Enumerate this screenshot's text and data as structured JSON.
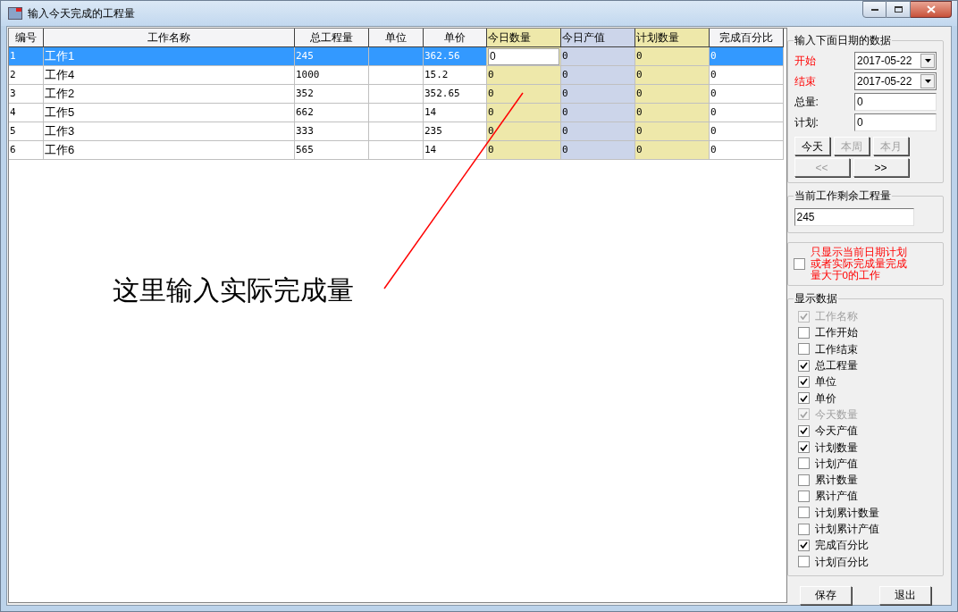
{
  "window": {
    "title": "输入今天完成的工程量"
  },
  "table": {
    "columns": [
      {
        "label": "编号"
      },
      {
        "label": "工作名称"
      },
      {
        "label": "总工程量"
      },
      {
        "label": "单位"
      },
      {
        "label": "单价"
      },
      {
        "label": "今日数量",
        "color": "#eee8aa",
        "kind": "input"
      },
      {
        "label": "今日产值",
        "color": "#ccd5ea"
      },
      {
        "label": "计划数量",
        "color": "#eee8aa"
      },
      {
        "label": "完成百分比"
      }
    ],
    "rows": [
      {
        "selected": true,
        "editing": true,
        "cells": [
          "1",
          "工作1",
          "245",
          "",
          "362.56",
          "0",
          "0",
          "0",
          "0"
        ]
      },
      {
        "selected": false,
        "editing": false,
        "cells": [
          "2",
          "工作4",
          "1000",
          "",
          "15.2",
          "0",
          "0",
          "0",
          "0"
        ]
      },
      {
        "selected": false,
        "editing": false,
        "cells": [
          "3",
          "工作2",
          "352",
          "",
          "352.65",
          "0",
          "0",
          "0",
          "0"
        ]
      },
      {
        "selected": false,
        "editing": false,
        "cells": [
          "4",
          "工作5",
          "662",
          "",
          "14",
          "0",
          "0",
          "0",
          "0"
        ]
      },
      {
        "selected": false,
        "editing": false,
        "cells": [
          "5",
          "工作3",
          "333",
          "",
          "235",
          "0",
          "0",
          "0",
          "0"
        ]
      },
      {
        "selected": false,
        "editing": false,
        "cells": [
          "6",
          "工作6",
          "565",
          "",
          "14",
          "0",
          "0",
          "0",
          "0"
        ]
      }
    ]
  },
  "annotation": {
    "text": "这里输入实际完成量"
  },
  "date_group": {
    "title": "输入下面日期的数据",
    "start": {
      "label": "开始",
      "value": "2017-05-22"
    },
    "end": {
      "label": "结束",
      "value": "2017-05-22"
    },
    "total": {
      "label": "总量:",
      "value": "0"
    },
    "plan": {
      "label": "计划:",
      "value": "0"
    },
    "buttons": [
      {
        "label": "今天",
        "disabled": false
      },
      {
        "label": "本周",
        "disabled": true
      },
      {
        "label": "本月",
        "disabled": true
      }
    ],
    "nav": [
      {
        "label": "<<",
        "disabled": true
      },
      {
        "label": ">>",
        "disabled": false
      }
    ]
  },
  "remaining": {
    "title": "当前工作剩余工程量",
    "value": "245"
  },
  "filter": {
    "checked": false,
    "label": "只显示当前日期计划或者实际完成量完成量大于0的工作"
  },
  "display": {
    "title": "显示数据",
    "items": [
      {
        "label": "工作名称",
        "checked": true,
        "disabled": true
      },
      {
        "label": "工作开始",
        "checked": false,
        "disabled": false
      },
      {
        "label": "工作结束",
        "checked": false,
        "disabled": false
      },
      {
        "label": "总工程量",
        "checked": true,
        "disabled": false
      },
      {
        "label": "单位",
        "checked": true,
        "disabled": false
      },
      {
        "label": "单价",
        "checked": true,
        "disabled": false
      },
      {
        "label": "今天数量",
        "checked": true,
        "disabled": true
      },
      {
        "label": "今天产值",
        "checked": true,
        "disabled": false
      },
      {
        "label": "计划数量",
        "checked": true,
        "disabled": false
      },
      {
        "label": "计划产值",
        "checked": false,
        "disabled": false
      },
      {
        "label": "累计数量",
        "checked": false,
        "disabled": false
      },
      {
        "label": "累计产值",
        "checked": false,
        "disabled": false
      },
      {
        "label": "计划累计数量",
        "checked": false,
        "disabled": false
      },
      {
        "label": "计划累计产值",
        "checked": false,
        "disabled": false
      },
      {
        "label": "完成百分比",
        "checked": true,
        "disabled": false
      },
      {
        "label": "计划百分比",
        "checked": false,
        "disabled": false
      }
    ]
  },
  "buttons": [
    "保存",
    "退出"
  ]
}
